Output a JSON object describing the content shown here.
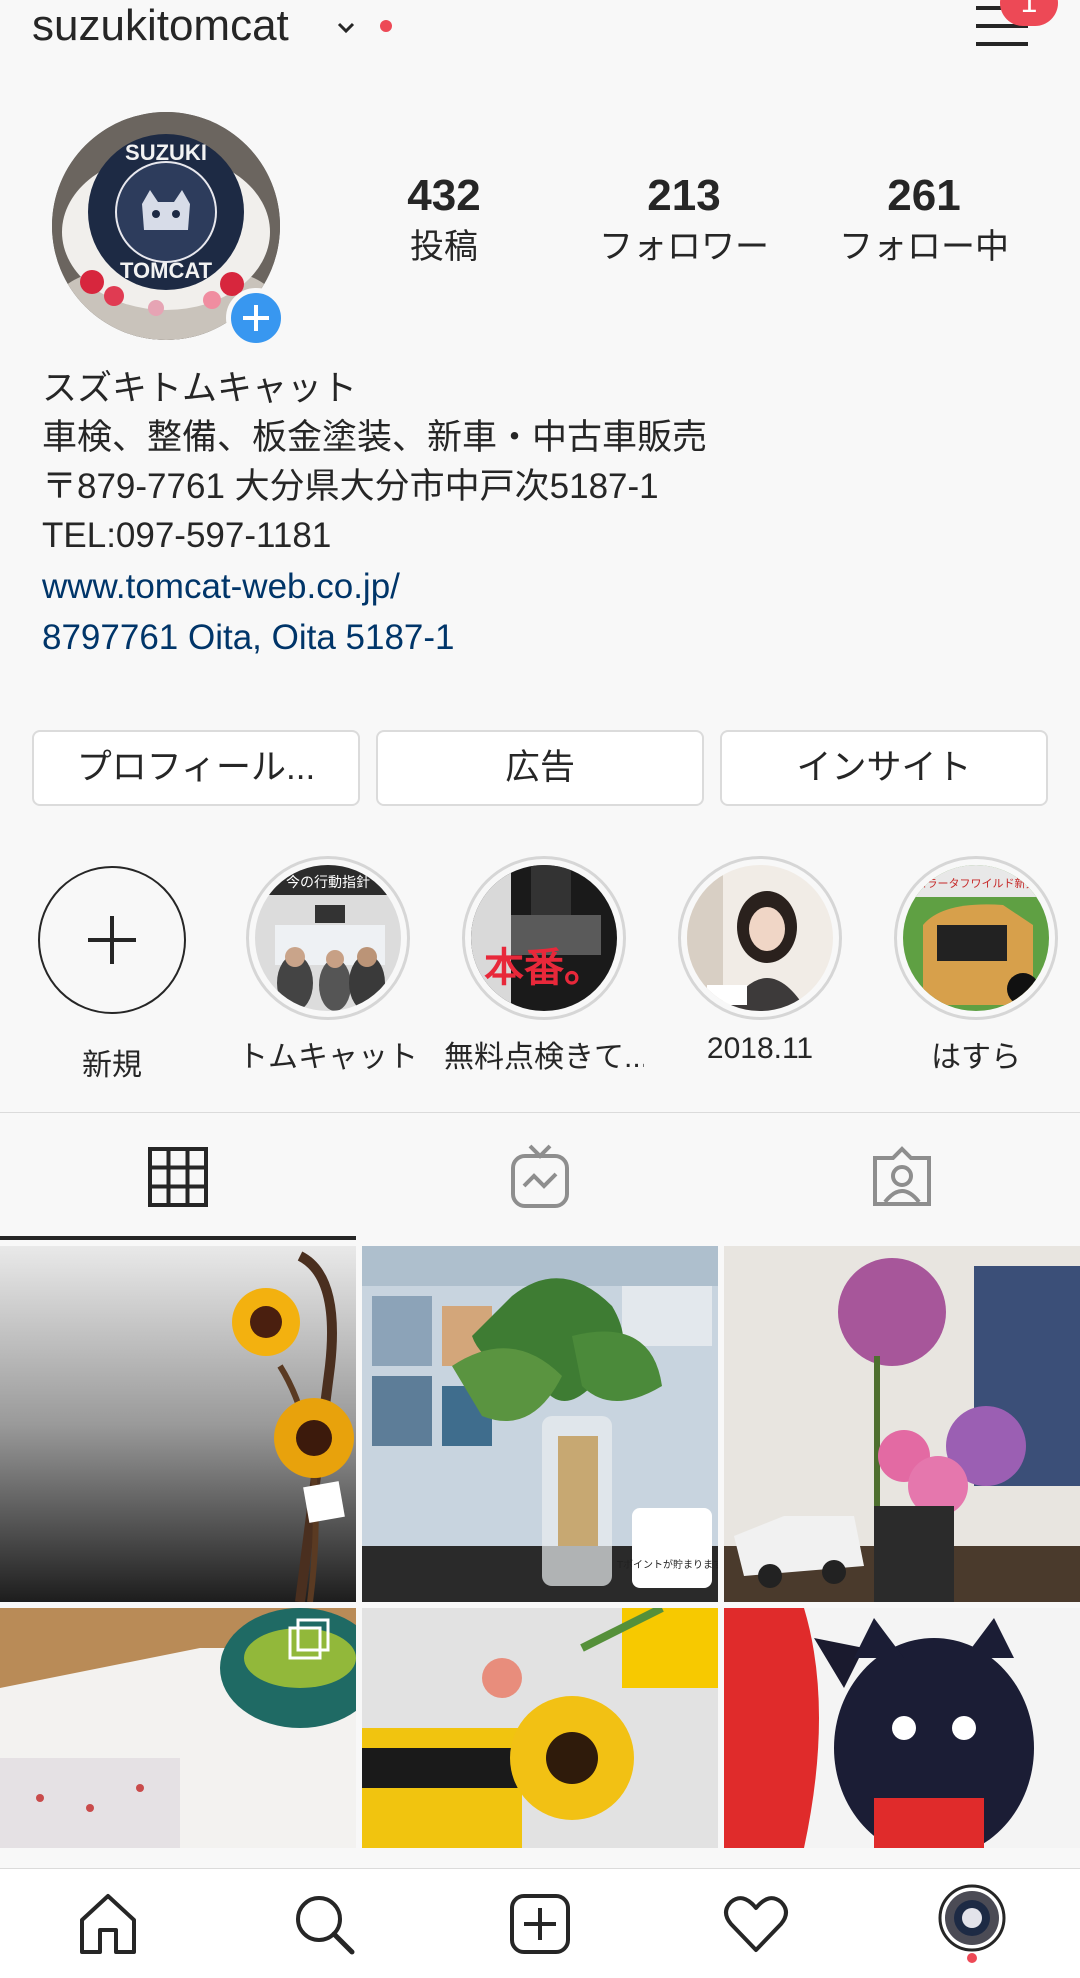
{
  "header": {
    "username": "suzukitomcat",
    "menu_badge": "1"
  },
  "avatar": {
    "logo_line1": "SUZUKI",
    "logo_line2": "TOMCAT"
  },
  "stats": [
    {
      "value": "432",
      "label": "投稿"
    },
    {
      "value": "213",
      "label": "フォロワー"
    },
    {
      "value": "261",
      "label": "フォロー中"
    }
  ],
  "bio": {
    "name": "スズキトムキャット",
    "line1": "車検、整備、板金塗装、新車・中古車販売",
    "line2": "〒879-7761 大分県大分市中戸次5187-1",
    "line3": "TEL:097-597-1181",
    "website": "www.tomcat-web.co.jp/",
    "address": "8797761 Oita, Oita 5187-1"
  },
  "buttons": {
    "profile": "プロフィール...",
    "ads": "広告",
    "insights": "インサイト"
  },
  "highlights": [
    {
      "label": "新規"
    },
    {
      "label": "トムキャット",
      "overlay": "今の行動指針"
    },
    {
      "label": "無料点検きて...",
      "overlay": "本番。"
    },
    {
      "label": "2018.11"
    },
    {
      "label": "はすら",
      "overlay": "ハスラータフワイルド新発売"
    }
  ],
  "grid_text": {
    "tpoint": "Tポイントが貯まります!"
  },
  "colors": {
    "accent": "#3897f0",
    "notify": "#ed4956",
    "link": "#003569"
  }
}
